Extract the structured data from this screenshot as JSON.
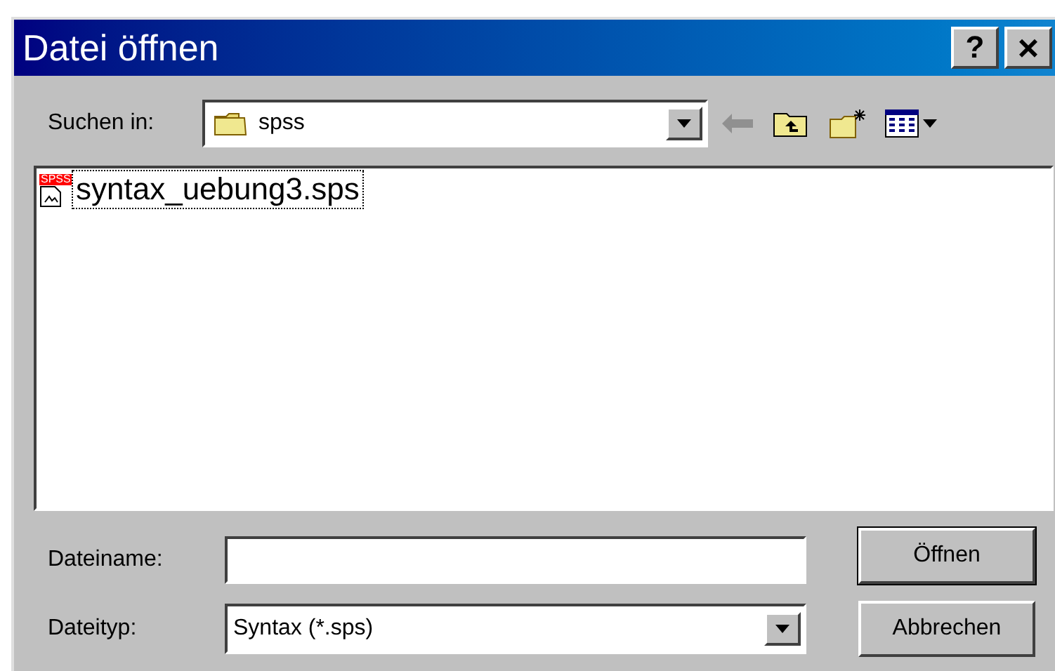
{
  "window": {
    "title": "Datei öffnen",
    "help": "?",
    "close": "×"
  },
  "look_in": {
    "label": "Suchen in:",
    "value": "spss"
  },
  "files": [
    {
      "name": "syntax_uebung3.sps",
      "badge": "SPSS",
      "selected": true
    }
  ],
  "filename": {
    "label": "Dateiname:"
  },
  "filetype": {
    "label": "Dateityp:",
    "value": "Syntax (*.sps)"
  },
  "buttons": [
    {
      "label": "Öffnen",
      "default": true
    },
    {
      "label": "Abbrechen",
      "default": false
    }
  ]
}
